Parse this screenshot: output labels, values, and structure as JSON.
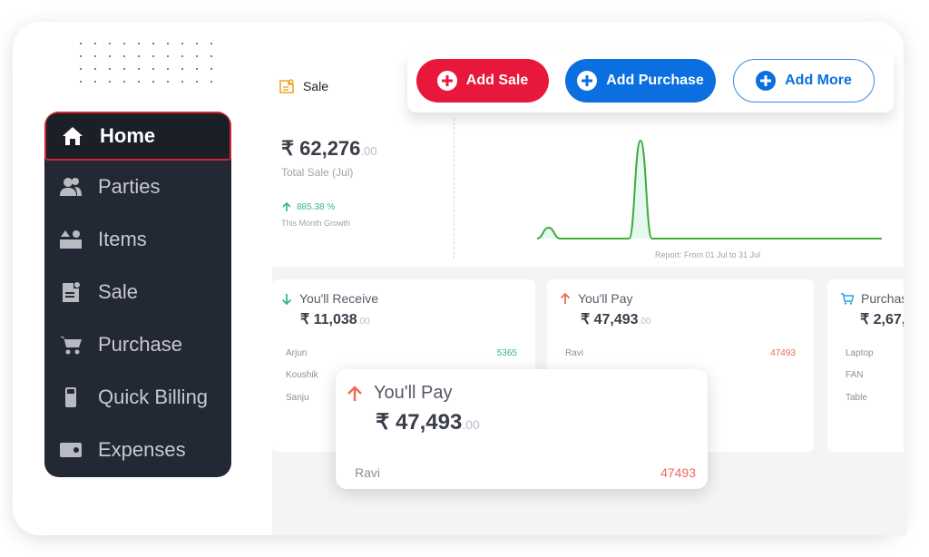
{
  "sidebar": {
    "items": [
      {
        "label": "Home",
        "icon": "home-icon",
        "active": true
      },
      {
        "label": "Parties",
        "icon": "users-icon"
      },
      {
        "label": "Items",
        "icon": "items-icon"
      },
      {
        "label": "Sale",
        "icon": "sale-icon"
      },
      {
        "label": "Purchase",
        "icon": "cart-icon"
      },
      {
        "label": "Quick Billing",
        "icon": "pos-terminal-icon"
      },
      {
        "label": "Expenses",
        "icon": "wallet-icon"
      }
    ]
  },
  "actions": {
    "add_sale": "Add Sale",
    "add_purchase": "Add Purchase",
    "add_more": "Add More"
  },
  "sale": {
    "title": "Sale",
    "currency": "₹",
    "amount": "₹ 62,276",
    "amount_decimal": ".00",
    "subtitle": "Total Sale (Jul)",
    "growth": "885.38 %",
    "growth_label": "This Month Growth",
    "report_label": "Report: From 01 Jul to 31 Jul"
  },
  "chart_data": {
    "type": "area",
    "title": "",
    "xlabel": "",
    "ylabel": "",
    "x": [
      1,
      2,
      3,
      4,
      5,
      6,
      7,
      8,
      9,
      10,
      11,
      12,
      13,
      14,
      15,
      16,
      17,
      18,
      19,
      20,
      21,
      22,
      23,
      24,
      25,
      26,
      27,
      28,
      29,
      30,
      31
    ],
    "values": [
      0,
      6200,
      0,
      0,
      0,
      0,
      0,
      0,
      0,
      56076,
      0,
      0,
      0,
      0,
      0,
      0,
      0,
      0,
      0,
      0,
      0,
      0,
      0,
      0,
      0,
      0,
      0,
      0,
      0,
      0,
      0
    ],
    "color": "#3cae3c",
    "fill": "#e6f8f0",
    "grid": false
  },
  "cards": {
    "receive": {
      "title": "You'll Receive",
      "amount": "₹ 11,038",
      "decimal": ".00",
      "rows": [
        {
          "name": "Arjun",
          "value": "5365"
        },
        {
          "name": "Koushik",
          "value": ""
        },
        {
          "name": "Sanju",
          "value": ""
        }
      ]
    },
    "pay": {
      "title": "You'll Pay",
      "amount": "₹ 47,493",
      "decimal": ".00",
      "rows": [
        {
          "name": "Ravi",
          "value": "47493"
        }
      ]
    },
    "purchase": {
      "title": "Purchas",
      "amount": "₹ 2,67,",
      "rows": [
        {
          "name": "Laptop"
        },
        {
          "name": "FAN"
        },
        {
          "name": "Table"
        }
      ]
    }
  },
  "popup": {
    "title": "You'll Pay",
    "amount": "₹ 47,493",
    "decimal": ".00",
    "row_name": "Ravi",
    "row_value": "47493"
  },
  "colors": {
    "accent_red": "#e8183c",
    "accent_blue": "#0b6fdf",
    "positive": "#34b87a",
    "negative": "#f0675a"
  }
}
